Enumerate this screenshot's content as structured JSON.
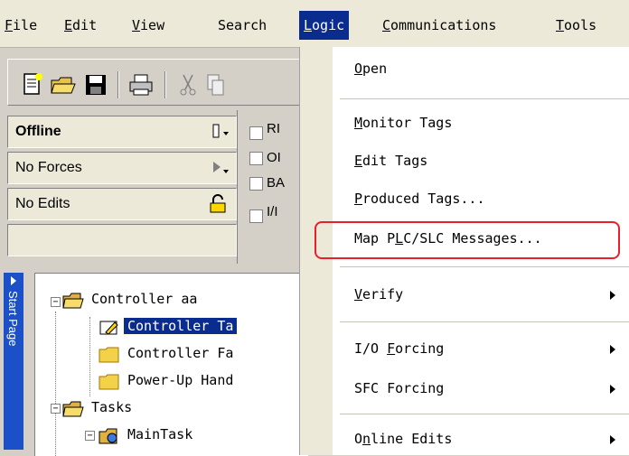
{
  "menubar": {
    "items": [
      "File",
      "Edit",
      "View",
      "Search",
      "Logic",
      "Communications",
      "Tools"
    ],
    "active": "Logic"
  },
  "toolbar": {
    "buttons": [
      "new-icon",
      "open-icon",
      "save-icon",
      "print-icon",
      "cut-icon",
      "copy-icon"
    ]
  },
  "status": {
    "mode": "Offline",
    "forces": "No Forces",
    "edits": "No Edits",
    "checkbox_labels": [
      "RI",
      "OI",
      "BA",
      "I/І"
    ]
  },
  "side_tab": {
    "label": "Start Page"
  },
  "tree": {
    "items": [
      {
        "label": "Controller aa",
        "level": 0,
        "expander": "-"
      },
      {
        "label": "Controller Ta",
        "level": 1,
        "selected": true
      },
      {
        "label": "Controller Fa",
        "level": 1
      },
      {
        "label": "Power-Up Hand",
        "level": 1
      },
      {
        "label": "Tasks",
        "level": 0,
        "expander": "-"
      },
      {
        "label": "MainTask",
        "level": 1,
        "expander": "-"
      }
    ]
  },
  "menu": {
    "open": "Open",
    "monitor_tags": "Monitor Tags",
    "edit_tags": "Edit Tags",
    "produced_tags": "Produced Tags...",
    "map_plc": "Map PLC/SLC Messages...",
    "verify": "Verify",
    "io_forcing": "I/O Forcing",
    "sfc_forcing": "SFC Forcing",
    "online_edits": "Online Edits"
  },
  "colors": {
    "menu_highlight": "#0b2c8f",
    "annotation_box": "#e8202a"
  }
}
